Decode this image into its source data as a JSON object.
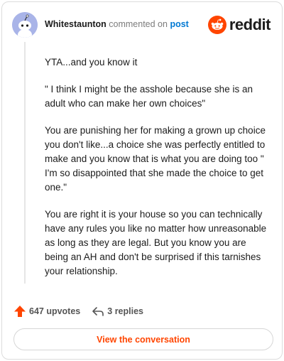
{
  "comment": {
    "username": "Whitestaunton",
    "action_text": "commented on",
    "post_link": "post",
    "paragraphs": [
      "YTA...and you know it",
      "\" I think I might be the asshole because she is an adult who can make her own choices\"",
      "You are punishing her for making a grown up choice you don't like...a choice she was perfectly entitled to make and you know that is what you are doing too \" I'm so disappointed that she made the choice to get one.\"",
      "You are right it is your house so you can technically have any rules you like no matter how unreasonable as long as they are legal. But you know you are being an AH and don't be surprised if this tarnishes your relationship."
    ]
  },
  "brand": {
    "wordmark": "reddit",
    "color": "#ff4500"
  },
  "footer": {
    "upvotes": "647 upvotes",
    "replies": "3 replies",
    "view_button": "View the conversation"
  },
  "icons": {
    "avatar": "snoo-avatar-icon",
    "logo": "reddit-logo-icon",
    "upvote": "upvote-arrow-icon",
    "reply": "reply-arrow-icon"
  },
  "colors": {
    "accent": "#ff4500",
    "link": "#0079d3",
    "avatar_bg": "#a9b4e8"
  }
}
